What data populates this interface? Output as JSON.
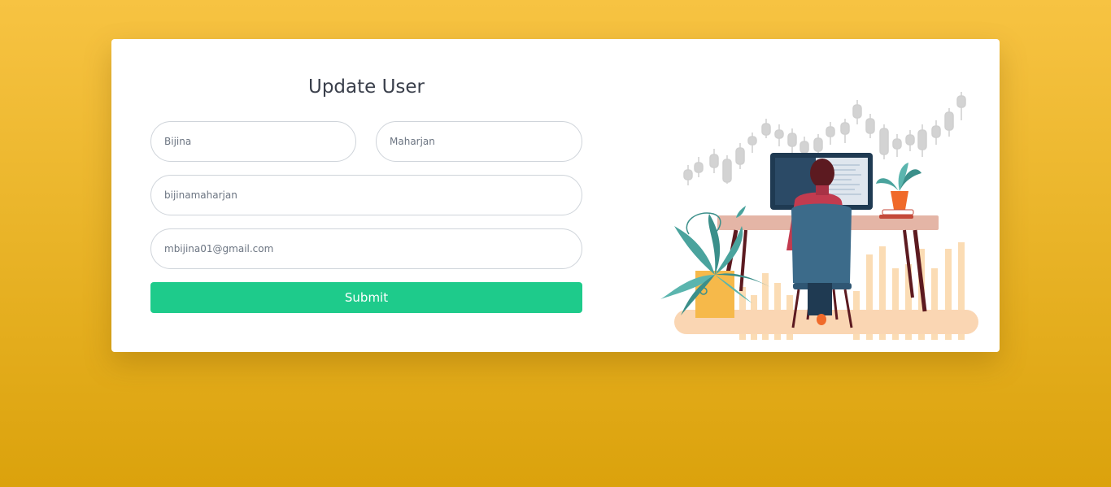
{
  "form": {
    "title": "Update User",
    "first_name": {
      "value": "Bijina"
    },
    "last_name": {
      "value": "Maharjan"
    },
    "username": {
      "value": "bijinamaharjan"
    },
    "email": {
      "value": "mbijina01@gmail.com"
    },
    "submit_label": "Submit"
  },
  "colors": {
    "background": "#f7c342",
    "submit": "#1ecb8b",
    "title": "#3a3f4b"
  },
  "illustration": {
    "icon": "developer-at-desk-illustration"
  }
}
